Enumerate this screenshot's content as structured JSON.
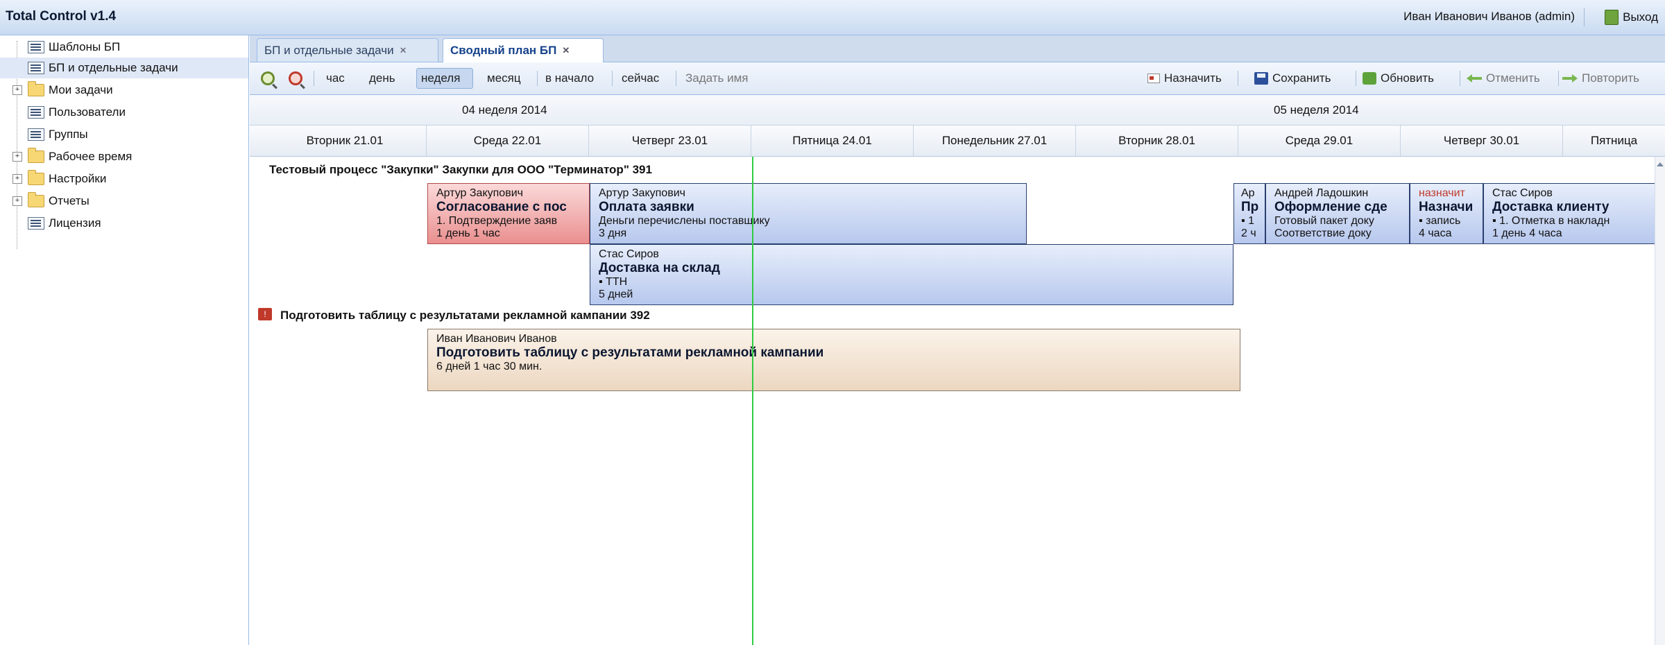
{
  "app": {
    "title": "Total Control v1.4",
    "user": "Иван Иванович Иванов (admin)",
    "logout_label": "Выход"
  },
  "sidebar": {
    "items": [
      {
        "label": "Шаблоны БП",
        "icon": "document-list-icon"
      },
      {
        "label": "БП и отдельные задачи",
        "icon": "document-list-icon",
        "selected": true
      },
      {
        "label": "Мои задачи",
        "icon": "folder-icon",
        "expandable": true
      },
      {
        "label": "Пользователи",
        "icon": "document-list-icon"
      },
      {
        "label": "Группы",
        "icon": "document-list-icon"
      },
      {
        "label": "Рабочее время",
        "icon": "folder-icon",
        "expandable": true
      },
      {
        "label": "Настройки",
        "icon": "folder-icon",
        "expandable": true
      },
      {
        "label": "Отчеты",
        "icon": "folder-icon",
        "expandable": true
      },
      {
        "label": "Лицензия",
        "icon": "document-list-icon"
      }
    ]
  },
  "tabs": [
    {
      "label": "БП и отдельные задачи",
      "active": false
    },
    {
      "label": "Сводный план БП",
      "active": true
    }
  ],
  "toolbar": {
    "hour": "час",
    "day": "день",
    "week": "неделя",
    "month": "месяц",
    "to_start": "в начало",
    "now": "сейчас",
    "set_name": "Задать имя",
    "assign": "Назначить",
    "save": "Сохранить",
    "refresh": "Обновить",
    "undo": "Отменить",
    "redo": "Повторить"
  },
  "timeline": {
    "weeks": [
      "04 неделя 2014",
      "05 неделя 2014"
    ],
    "days": [
      "Вторник 21.01",
      "Среда 22.01",
      "Четверг 23.01",
      "Пятница 24.01",
      "Понедельник 27.01",
      "Вторник 28.01",
      "Среда 29.01",
      "Четверг 30.01",
      "Пятница"
    ]
  },
  "groups": [
    {
      "title": "Тестовый процесс \"Закупки\" Закупки для ООО \"Терминатор\" 391"
    },
    {
      "title": "Подготовить таблицу с результатами рекламной кампании 392",
      "icon": "task-red-icon",
      "icon_text": "!"
    }
  ],
  "tasks": [
    {
      "who": "Артур Закупович",
      "name": "Согласование с пос",
      "desc": "1. Подтверждение заяв",
      "dur": "1 день 1 час",
      "color": "red"
    },
    {
      "who": "Артур Закупович",
      "name": "Оплата заявки",
      "desc": "Деньги перечислены поставщику",
      "dur": "3 дня",
      "color": "blue"
    },
    {
      "who": "Стас Сиров",
      "name": "Доставка на склад",
      "desc": "▪ ТТН",
      "dur": "5 дней",
      "color": "blue"
    },
    {
      "who": "Ар",
      "name": "Пр",
      "desc": "▪ 1",
      "dur": "2 ч",
      "color": "blue"
    },
    {
      "who": "Андрей Ладошкин",
      "name": "Оформление сде",
      "desc": "Готовый пакет доку",
      "dur": "Соответствие доку",
      "color": "blue"
    },
    {
      "who": "назначит",
      "name": "Назначи",
      "desc": "▪ запись",
      "dur": "4 часа",
      "color": "blue"
    },
    {
      "who": "Стас Сиров",
      "name": "Доставка клиенту",
      "desc": "▪ 1. Отметка в накладн",
      "dur": "1 день 4 часа",
      "color": "blue"
    },
    {
      "who": "Иван Иванович Иванов",
      "name": "Подготовить таблицу с результатами рекламной кампании",
      "desc": "",
      "dur": "6 дней 1 час 30 мин.",
      "color": "beige"
    }
  ]
}
